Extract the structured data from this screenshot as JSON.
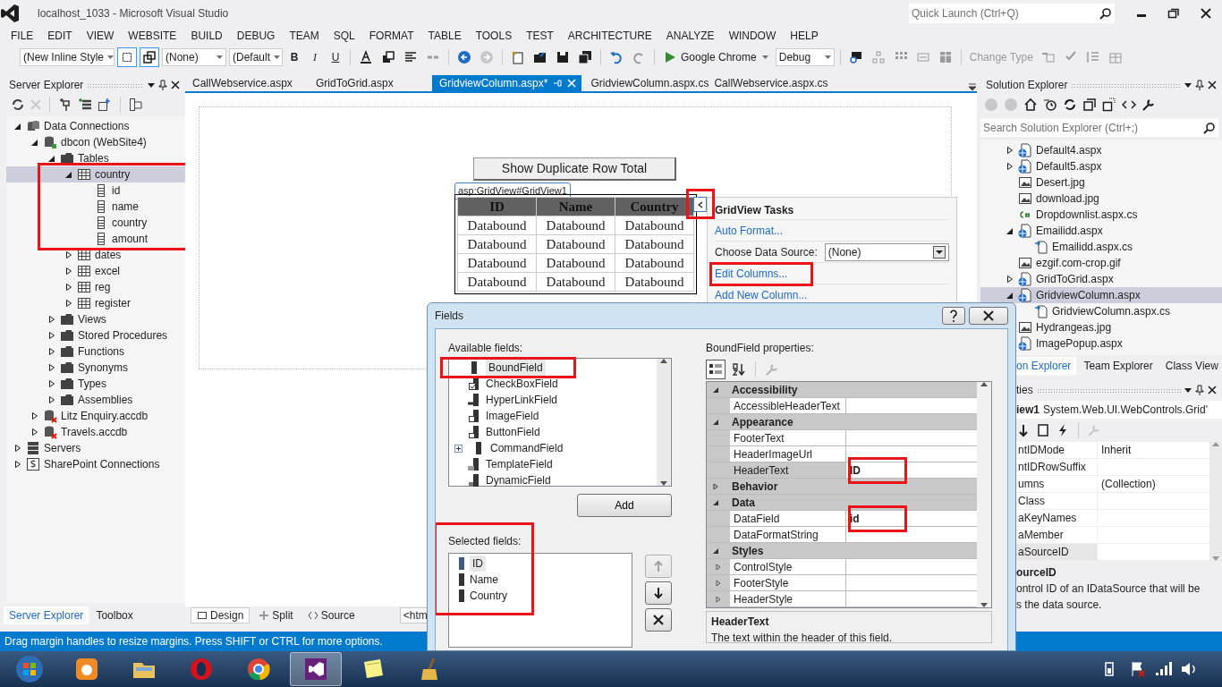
{
  "window": {
    "title": "localhost_1033 - Microsoft Visual Studio"
  },
  "quick_launch": {
    "placeholder": "Quick Launch (Ctrl+Q)"
  },
  "menu": [
    "FILE",
    "EDIT",
    "VIEW",
    "WEBSITE",
    "BUILD",
    "DEBUG",
    "TEAM",
    "SQL",
    "FORMAT",
    "TABLE",
    "TOOLS",
    "TEST",
    "ARCHITECTURE",
    "ANALYZE",
    "WINDOW",
    "HELP"
  ],
  "toolbar": {
    "style_combo": "(New Inline Style",
    "target_combo": "(None)",
    "font_combo": "(Default",
    "bold": "B",
    "italic": "I",
    "underline": "U",
    "browser": "Google Chrome",
    "configuration": "Debug",
    "change_type": "Change Type"
  },
  "server_explorer": {
    "title": "Server Explorer",
    "tree": [
      {
        "label": "Data Connections",
        "kind": "connections",
        "expanded": true,
        "selected": false,
        "children": [
          {
            "label": "dbcon (WebSite4)",
            "kind": "database",
            "expanded": true,
            "selected": false,
            "children": [
              {
                "label": "Tables",
                "kind": "folder",
                "expanded": true,
                "selected": false,
                "children": [
                  {
                    "label": "country",
                    "kind": "table",
                    "expanded": true,
                    "selected": true,
                    "highlighted": true,
                    "children": [
                      {
                        "label": "id",
                        "kind": "column",
                        "selected": false
                      },
                      {
                        "label": "name",
                        "kind": "column",
                        "selected": false
                      },
                      {
                        "label": "country",
                        "kind": "column",
                        "selected": false
                      },
                      {
                        "label": "amount",
                        "kind": "column",
                        "selected": false
                      }
                    ]
                  },
                  {
                    "label": "dates",
                    "kind": "table",
                    "expanded": false,
                    "selected": false
                  },
                  {
                    "label": "excel",
                    "kind": "table",
                    "expanded": false,
                    "selected": false
                  },
                  {
                    "label": "reg",
                    "kind": "table",
                    "expanded": false,
                    "selected": false
                  },
                  {
                    "label": "register",
                    "kind": "table",
                    "expanded": false,
                    "selected": false
                  }
                ]
              },
              {
                "label": "Views",
                "kind": "folder",
                "expanded": false,
                "selected": false
              },
              {
                "label": "Stored Procedures",
                "kind": "folder",
                "expanded": false,
                "selected": false
              },
              {
                "label": "Functions",
                "kind": "folder",
                "expanded": false,
                "selected": false
              },
              {
                "label": "Synonyms",
                "kind": "folder",
                "expanded": false,
                "selected": false
              },
              {
                "label": "Types",
                "kind": "folder",
                "expanded": false,
                "selected": false
              },
              {
                "label": "Assemblies",
                "kind": "folder",
                "expanded": false,
                "selected": false
              }
            ]
          },
          {
            "label": "Litz Enquiry.accdb",
            "kind": "database_error",
            "expanded": false,
            "selected": false
          },
          {
            "label": "Travels.accdb",
            "kind": "database_error",
            "expanded": false,
            "selected": false
          }
        ]
      },
      {
        "label": "Servers",
        "kind": "server",
        "expanded": false,
        "selected": false
      },
      {
        "label": "SharePoint Connections",
        "kind": "sharepoint",
        "expanded": false,
        "selected": false
      }
    ],
    "tabs": [
      {
        "label": "Server Explorer",
        "selected": true
      },
      {
        "label": "Toolbox",
        "selected": false
      }
    ]
  },
  "editor": {
    "tabs": [
      {
        "label": "CallWebservice.aspx",
        "selected": false
      },
      {
        "label": "GridToGrid.aspx",
        "selected": false
      },
      {
        "label": "GridviewColumn.aspx*",
        "selected": true
      },
      {
        "label": "GridviewColumn.aspx.cs",
        "selected": false
      },
      {
        "label": "CallWebservice.aspx.cs",
        "selected": false
      }
    ],
    "design": {
      "button": "Show Duplicate Row Total",
      "tag": "asp:GridView#GridView1",
      "grid": {
        "columns": [
          "ID",
          "Name",
          "Country"
        ],
        "rows": [
          [
            "Databound",
            "Databound",
            "Databound"
          ],
          [
            "Databound",
            "Databound",
            "Databound"
          ],
          [
            "Databound",
            "Databound",
            "Databound"
          ],
          [
            "Databound",
            "Databound",
            "Databound"
          ]
        ]
      },
      "smart_tag": {
        "highlighted": true
      },
      "tasks": {
        "title": "GridView Tasks",
        "items": [
          {
            "kind": "link",
            "label": "Auto Format..."
          },
          {
            "kind": "combo",
            "label": "Choose Data Source:",
            "value": "(None)"
          },
          {
            "kind": "link",
            "label": "Edit Columns...",
            "highlighted": true
          },
          {
            "kind": "link",
            "label": "Add New Column..."
          }
        ]
      }
    },
    "views": [
      {
        "label": "Design",
        "selected": true
      },
      {
        "label": "Split",
        "selected": false
      },
      {
        "label": "Source",
        "selected": false
      }
    ],
    "breadcrumb": "<htm"
  },
  "solution_explorer": {
    "title": "Solution Explorer",
    "search": {
      "placeholder": "Search Solution Explorer (Ctrl+;)"
    },
    "items": [
      {
        "label": "Default4.aspx",
        "kind": "web",
        "expanded": false,
        "selected": false
      },
      {
        "label": "Default5.aspx",
        "kind": "web",
        "expanded": false,
        "selected": false
      },
      {
        "label": "Desert.jpg",
        "kind": "image",
        "selected": false
      },
      {
        "label": "download.jpg",
        "kind": "image",
        "selected": false
      },
      {
        "label": "Dropdownlist.aspx.cs",
        "kind": "csharp",
        "selected": false
      },
      {
        "label": "Emailidd.aspx",
        "kind": "web",
        "expanded": true,
        "selected": false,
        "children": [
          {
            "label": "Emailidd.aspx.cs",
            "kind": "codebehind",
            "selected": false
          }
        ]
      },
      {
        "label": "ezgif.com-crop.gif",
        "kind": "image",
        "selected": false
      },
      {
        "label": "GridToGrid.aspx",
        "kind": "web",
        "expanded": false,
        "selected": false
      },
      {
        "label": "GridviewColumn.aspx",
        "kind": "web",
        "expanded": true,
        "selected": true,
        "children": [
          {
            "label": "GridviewColumn.aspx.cs",
            "kind": "codebehind",
            "selected": false
          }
        ]
      },
      {
        "label": "Hydrangeas.jpg",
        "kind": "image",
        "selected": false
      },
      {
        "label": "ImagePopup.aspx",
        "kind": "web",
        "selected": false
      }
    ],
    "tabs": [
      {
        "label": "on Explorer",
        "selected": true
      },
      {
        "label": "Team Explorer",
        "selected": false
      },
      {
        "label": "Class View",
        "selected": false
      }
    ]
  },
  "properties": {
    "title": "ties",
    "object_name": "iew1",
    "object_type": "System.Web.UI.WebControls.Grid'",
    "rows": [
      {
        "name": "ntIDMode",
        "value": "Inherit",
        "selected": false
      },
      {
        "name": "ntIDRowSuffix",
        "selected": false
      },
      {
        "name": "umns",
        "value": "(Collection)",
        "selected": false
      },
      {
        "name": "Class",
        "selected": false
      },
      {
        "name": "aKeyNames",
        "selected": false
      },
      {
        "name": "aMember",
        "selected": false
      },
      {
        "name": "aSourceID",
        "selected": true
      }
    ],
    "description_title": "ourceID",
    "description_lines": [
      "ontrol ID of an IDataSource that will be",
      "s the data source."
    ]
  },
  "dialog": {
    "title": "Fields",
    "available_label": "Available fields:",
    "available": [
      {
        "label": "BoundField",
        "kind": "bound",
        "selected": true,
        "highlighted": true
      },
      {
        "label": "CheckBoxField",
        "kind": "checkbox",
        "selected": false
      },
      {
        "label": "HyperLinkField",
        "kind": "hyperlink",
        "selected": false
      },
      {
        "label": "ImageField",
        "kind": "image",
        "selected": false
      },
      {
        "label": "ButtonField",
        "kind": "button",
        "selected": false
      },
      {
        "label": "CommandField",
        "kind": "command",
        "selected": false
      },
      {
        "label": "TemplateField",
        "kind": "template",
        "selected": false
      },
      {
        "label": "DynamicField",
        "kind": "dynamic",
        "selected": false
      }
    ],
    "add_button": "Add",
    "selected_label": "Selected fields:",
    "selected_highlighted": true,
    "selected_fields": [
      {
        "label": "ID",
        "selected": true
      },
      {
        "label": "Name",
        "selected": false
      },
      {
        "label": "Country",
        "selected": false
      }
    ],
    "properties_label": "BoundField properties:",
    "property_grid": [
      {
        "kind": "category",
        "label": "Accessibility",
        "expanded": true
      },
      {
        "kind": "property",
        "name": "AccessibleHeaderText",
        "selected": false
      },
      {
        "kind": "category",
        "label": "Appearance",
        "expanded": true
      },
      {
        "kind": "property",
        "name": "FooterText",
        "selected": false
      },
      {
        "kind": "property",
        "name": "HeaderImageUrl",
        "selected": false
      },
      {
        "kind": "property",
        "name": "HeaderText",
        "value": "ID",
        "selected": true,
        "highlighted": true
      },
      {
        "kind": "category",
        "label": "Behavior",
        "expanded": false
      },
      {
        "kind": "category",
        "label": "Data",
        "expanded": true
      },
      {
        "kind": "property",
        "name": "DataField",
        "value": "id",
        "selected": false,
        "highlighted": true
      },
      {
        "kind": "property",
        "name": "DataFormatString",
        "selected": false
      },
      {
        "kind": "category",
        "label": "Styles",
        "expanded": true
      },
      {
        "kind": "style",
        "name": "ControlStyle",
        "selected": false
      },
      {
        "kind": "style",
        "name": "FooterStyle",
        "selected": false
      },
      {
        "kind": "style",
        "name": "HeaderStyle",
        "selected": false
      }
    ],
    "description_title": "HeaderText",
    "description": "The text within the header of this field."
  },
  "status_bar": {
    "text": "Drag margin handles to resize margins. Press SHIFT or CTRL for more options."
  },
  "taskbar": [
    {
      "kind": "start",
      "active": false
    },
    {
      "kind": "uc",
      "active": false
    },
    {
      "kind": "explorer",
      "active": false
    },
    {
      "kind": "opera",
      "active": false
    },
    {
      "kind": "chrome",
      "active": false
    },
    {
      "kind": "vs",
      "active": true
    },
    {
      "kind": "notes",
      "active": false
    },
    {
      "kind": "cleaner",
      "active": false
    }
  ]
}
